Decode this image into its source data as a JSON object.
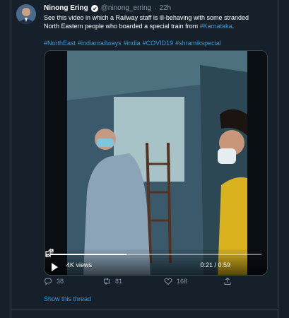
{
  "tweet": {
    "author_name": "Ninong Ering",
    "handle": "@ninong_erring",
    "separator": "·",
    "time": "22h",
    "text_before_link": "See this video in which a Railway staff is ill-behaving with some stranded North Eastern people who boarded a special train from ",
    "text_link": "#Karnataka",
    "text_after_link": ".",
    "hashtags": [
      "#NorthEast",
      "#indianrailways",
      "#india",
      "#COVID19",
      "#shramikspecial"
    ]
  },
  "video": {
    "views": "4K views",
    "timecode": "0:21 / 0:59",
    "progress": 0.36
  },
  "actions": {
    "replies": "38",
    "retweets": "81",
    "likes": "168"
  },
  "thread_link": "Show this thread",
  "colors": {
    "background": "#15202b",
    "accent": "#1da1f2",
    "muted": "#8899a6",
    "border": "#38444d"
  },
  "icons": [
    "verified-badge-icon",
    "play-icon",
    "volume-icon",
    "fullscreen-icon",
    "reply-icon",
    "retweet-icon",
    "like-icon",
    "share-icon"
  ]
}
